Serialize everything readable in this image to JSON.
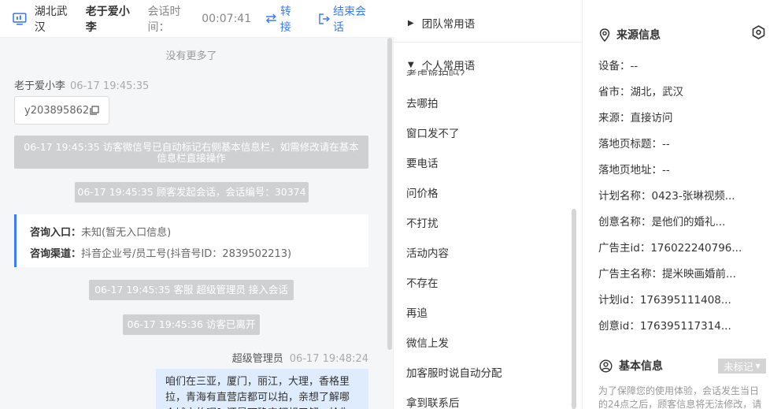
{
  "header": {
    "region": "湖北武汉",
    "visitor_name": "老于爱小李",
    "time_label": "会话时间：",
    "time_value": "00:07:41",
    "transfer_label": "转接",
    "end_label": "结束会话"
  },
  "chat": {
    "no_more": "没有更多了",
    "visitor_name": "老于爱小李",
    "visitor_time": "06-17 19:45:35",
    "code_text": "y203895862",
    "sys1": "06-17 19:45:35 访客微信号已自动标记右侧基本信息栏，如需修改请在基本信息栏直接操作",
    "sys2": "06-17 19:45:35 顾客发起会话，会话编号：30374",
    "entry_key": "咨询入口：",
    "entry_val": "未知(暂无入口信息)",
    "channel_key": "咨询渠道：",
    "channel_val": "抖音企业号/员工号(抖音号ID：2839502213)",
    "sys3": "06-17 19:45:35 客服 超级管理员 接入会话",
    "sys4": "06-17 19:45:36 访客已离开",
    "agent_name": "超级管理员",
    "agent_time": "06-17 19:48:24",
    "agent_msg": "咱们在三亚，厦门，丽江，大理，香格里拉，青海有直营店都可以拍，亲想了解哪个城市的呢？还是下确定都想了解，给你"
  },
  "phrases": {
    "team_label": "团队常用语",
    "personal_label": "个人常用语",
    "partial_item": "考虑旅拍吗？",
    "items": [
      "去哪拍",
      "窗口发不了",
      "要电话",
      "问价格",
      "不打扰",
      "活动内容",
      "不存在",
      "再追",
      "微信上发",
      "加客服时说自动分配",
      "拿到联系后"
    ]
  },
  "side": {
    "source_title": "来源信息",
    "rows": [
      "设备：--",
      "省市：湖北，武汉",
      "来源：直接访问",
      "落地页标题：--",
      "落地页地址：--",
      "计划名称：0423-张琳视频...",
      "创意名称：是他们的婚礼...",
      "广告主id：176022240796...",
      "广告主名称：提米映画婚前...",
      "计划id：176395111408...",
      "创意id：176395117314..."
    ],
    "basic_title": "基本信息",
    "tag_label": "未标记",
    "notice": "为了保障您的使用体验，会话发生当日的24点之后，顾客信息将无法修改，请"
  }
}
